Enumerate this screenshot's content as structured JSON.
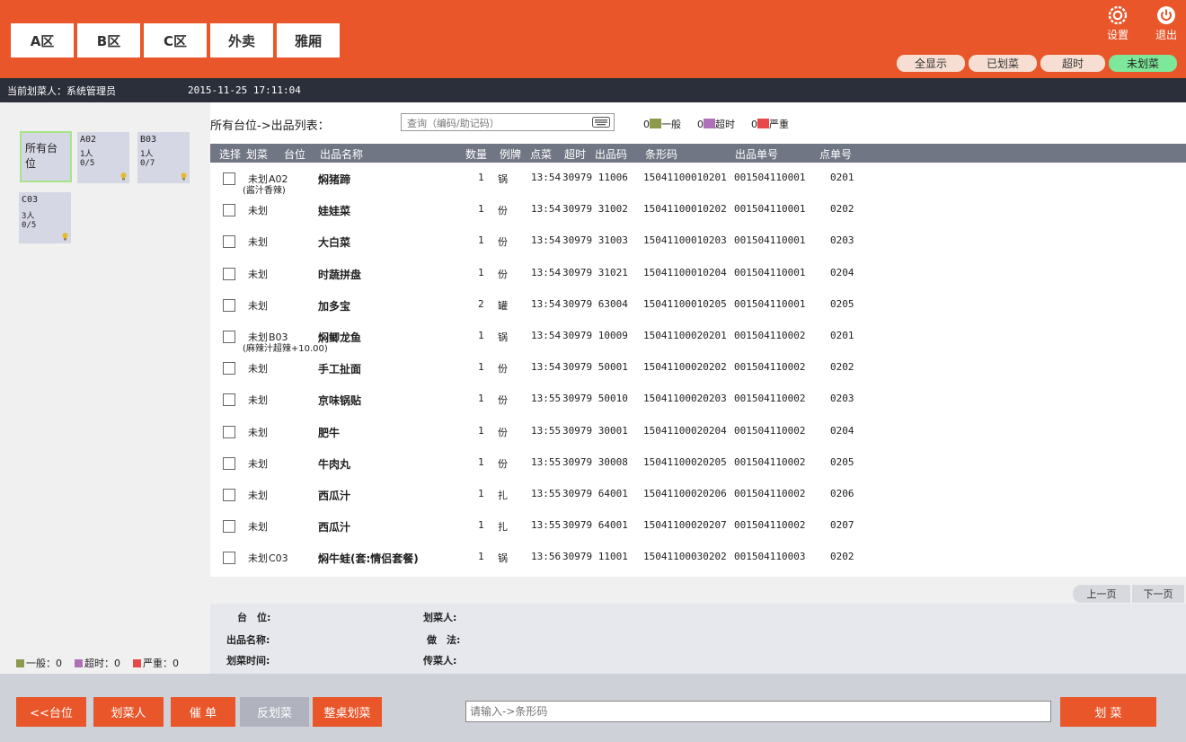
{
  "header": {
    "zones": [
      "A区",
      "B区",
      "C区",
      "外卖",
      "雅厢"
    ],
    "settings_label": "设置",
    "logout_label": "退出",
    "filters": [
      "全显示",
      "已划菜",
      "超时",
      "未划菜"
    ],
    "active_filter": "未划菜",
    "brand_color": "#e8562a"
  },
  "status": {
    "operator": "当前划菜人：系统管理员",
    "datetime": "2015-11-25 17:11:04"
  },
  "tables": [
    {
      "name": "所有台位",
      "people": "",
      "count": "",
      "selected": true
    },
    {
      "name": "A02",
      "people": "1人",
      "count": "0/5"
    },
    {
      "name": "B03",
      "people": "1人",
      "count": "0/7"
    },
    {
      "name": "C03",
      "people": "3人",
      "count": "0/5"
    }
  ],
  "left_legend": {
    "normal": "一般：0",
    "overtime": "超时：0",
    "severe": "严重：0"
  },
  "list": {
    "title": "所有台位->出品列表：",
    "search_placeholder": "查询（编码/助记码）",
    "legend": {
      "normal_count": "0",
      "normal_label": "一般",
      "overtime_count": "0",
      "overtime_label": "超时",
      "severe_count": "0",
      "severe_label": "严重"
    },
    "columns": [
      "选择",
      "划菜",
      "台位",
      "出品名称",
      "数量",
      "例牌",
      "点菜",
      "超时",
      "出品码",
      "条形码",
      "出品单号",
      "点单号"
    ],
    "rows": [
      {
        "state": "未划",
        "table": "A02",
        "note": "(酱汁香辣)",
        "name": "焖猪蹄",
        "qty": "1",
        "unit": "锅",
        "time": "13:54",
        "code": "30979 11006",
        "barcode": "15041100010201",
        "bill": "001504110001",
        "order": "0201"
      },
      {
        "state": "未划",
        "table": "",
        "note": "",
        "name": "娃娃菜",
        "qty": "1",
        "unit": "份",
        "time": "13:54",
        "code": "30979 31002",
        "barcode": "15041100010202",
        "bill": "001504110001",
        "order": "0202"
      },
      {
        "state": "未划",
        "table": "",
        "note": "",
        "name": "大白菜",
        "qty": "1",
        "unit": "份",
        "time": "13:54",
        "code": "30979 31003",
        "barcode": "15041100010203",
        "bill": "001504110001",
        "order": "0203"
      },
      {
        "state": "未划",
        "table": "",
        "note": "",
        "name": "时蔬拼盘",
        "qty": "1",
        "unit": "份",
        "time": "13:54",
        "code": "30979 31021",
        "barcode": "15041100010204",
        "bill": "001504110001",
        "order": "0204"
      },
      {
        "state": "未划",
        "table": "",
        "note": "",
        "name": "加多宝",
        "qty": "2",
        "unit": "罐",
        "time": "13:54",
        "code": "30979 63004",
        "barcode": "15041100010205",
        "bill": "001504110001",
        "order": "0205"
      },
      {
        "state": "未划",
        "table": "B03",
        "note": "(麻辣汁超辣+10.00)",
        "name": "焖鲫龙鱼",
        "qty": "1",
        "unit": "锅",
        "time": "13:54",
        "code": "30979 10009",
        "barcode": "15041100020201",
        "bill": "001504110002",
        "order": "0201"
      },
      {
        "state": "未划",
        "table": "",
        "note": "",
        "name": "手工扯面",
        "qty": "1",
        "unit": "份",
        "time": "13:54",
        "code": "30979 50001",
        "barcode": "15041100020202",
        "bill": "001504110002",
        "order": "0202"
      },
      {
        "state": "未划",
        "table": "",
        "note": "",
        "name": "京味锅贴",
        "qty": "1",
        "unit": "份",
        "time": "13:55",
        "code": "30979 50010",
        "barcode": "15041100020203",
        "bill": "001504110002",
        "order": "0203"
      },
      {
        "state": "未划",
        "table": "",
        "note": "",
        "name": "肥牛",
        "qty": "1",
        "unit": "份",
        "time": "13:55",
        "code": "30979 30001",
        "barcode": "15041100020204",
        "bill": "001504110002",
        "order": "0204"
      },
      {
        "state": "未划",
        "table": "",
        "note": "",
        "name": "牛肉丸",
        "qty": "1",
        "unit": "份",
        "time": "13:55",
        "code": "30979 30008",
        "barcode": "15041100020205",
        "bill": "001504110002",
        "order": "0205"
      },
      {
        "state": "未划",
        "table": "",
        "note": "",
        "name": "西瓜汁",
        "qty": "1",
        "unit": "扎",
        "time": "13:55",
        "code": "30979 64001",
        "barcode": "15041100020206",
        "bill": "001504110002",
        "order": "0206"
      },
      {
        "state": "未划",
        "table": "",
        "note": "",
        "name": "西瓜汁",
        "qty": "1",
        "unit": "扎",
        "time": "13:55",
        "code": "30979 64001",
        "barcode": "15041100020207",
        "bill": "001504110002",
        "order": "0207"
      },
      {
        "state": "未划",
        "table": "C03",
        "note": "",
        "name": "焖牛蛙(套:情侣套餐)",
        "qty": "1",
        "unit": "锅",
        "time": "13:56",
        "code": "30979 11001",
        "barcode": "15041100030202",
        "bill": "001504110003",
        "order": "0202"
      }
    ]
  },
  "pager": {
    "prev": "上一页",
    "next": "下一页"
  },
  "detail": {
    "table_label": "台　位:",
    "item_label": "出品名称:",
    "time_label": "划菜时间:",
    "server_label": "划菜人:",
    "method_label": "做　法:",
    "runner_label": "传菜人:"
  },
  "bottom": {
    "back": "<<台位",
    "server": "划菜人",
    "urge": "催 单",
    "unserve": "反划菜",
    "serve_table": "整桌划菜",
    "barcode_placeholder": "请输入->条形码",
    "serve": "划 菜"
  },
  "colors": {
    "normal": "#8c9a4e",
    "overtime": "#b070b8",
    "severe": "#e84848"
  }
}
